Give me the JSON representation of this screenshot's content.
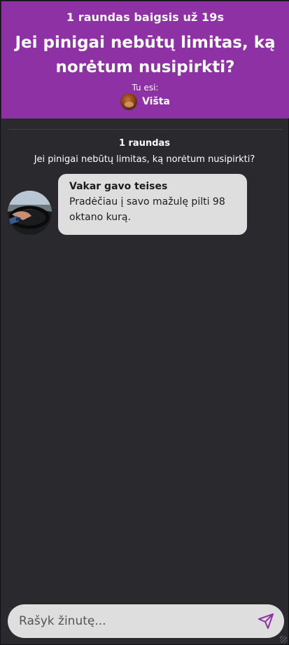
{
  "header": {
    "round_timer": "1 raundas baigsis už 19s",
    "question": "Jei pinigai nebūtų limitas, ką norėtum nusipirkti?",
    "you_are_label": "Tu esi:",
    "player_name": "Višta",
    "background_color": "#8e31a5"
  },
  "chat": {
    "round_label": "1 raundas",
    "round_question": "Jei pinigai nebūtų limitas, ką norėtum nusipirkti?",
    "messages": [
      {
        "author": "Vakar gavo teises",
        "text": "Pradėčiau į savo mažulę pilti 98 oktano kurą."
      }
    ]
  },
  "composer": {
    "placeholder": "Rašyk žinutę...",
    "send_icon": "send-icon",
    "accent_color": "#8e31a5"
  }
}
